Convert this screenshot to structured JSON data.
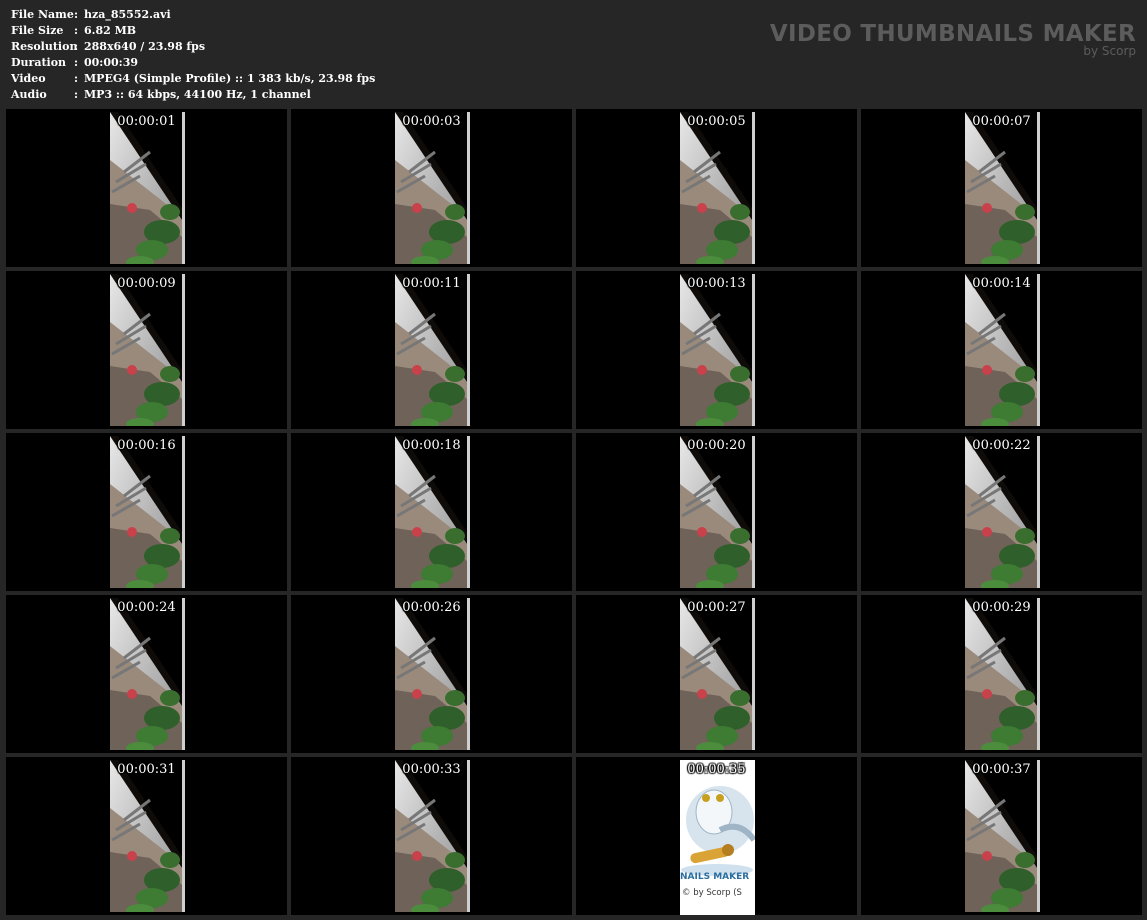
{
  "info": {
    "rows": [
      {
        "label": "File Name",
        "value": "hza_85552.avi"
      },
      {
        "label": "File Size",
        "value": "6.82 MB"
      },
      {
        "label": "Resolution",
        "value": "288x640 / 23.98 fps"
      },
      {
        "label": "Duration",
        "value": "00:00:39"
      },
      {
        "label": "Video",
        "value": "MPEG4 (Simple Profile) :: 1 383 kb/s, 23.98 fps"
      },
      {
        "label": "Audio",
        "value": "MP3 :: 64 kbps, 44100 Hz, 1 channel"
      }
    ],
    "separator": ":"
  },
  "brand": {
    "title": "VIDEO THUMBNAILS MAKER",
    "subtitle": "by Scorp"
  },
  "thumbnails": [
    {
      "time": "00:00:01"
    },
    {
      "time": "00:00:03"
    },
    {
      "time": "00:00:05"
    },
    {
      "time": "00:00:07"
    },
    {
      "time": "00:00:09"
    },
    {
      "time": "00:00:11"
    },
    {
      "time": "00:00:13"
    },
    {
      "time": "00:00:14"
    },
    {
      "time": "00:00:16"
    },
    {
      "time": "00:00:18"
    },
    {
      "time": "00:00:20"
    },
    {
      "time": "00:00:22"
    },
    {
      "time": "00:00:24"
    },
    {
      "time": "00:00:26"
    },
    {
      "time": "00:00:27"
    },
    {
      "time": "00:00:29"
    },
    {
      "time": "00:00:31"
    },
    {
      "time": "00:00:33"
    },
    {
      "time": "00:00:35",
      "logo": true,
      "logo_text": "NAILS MAKER",
      "logo_by": "© by Scorp (S"
    },
    {
      "time": "00:00:37"
    }
  ]
}
